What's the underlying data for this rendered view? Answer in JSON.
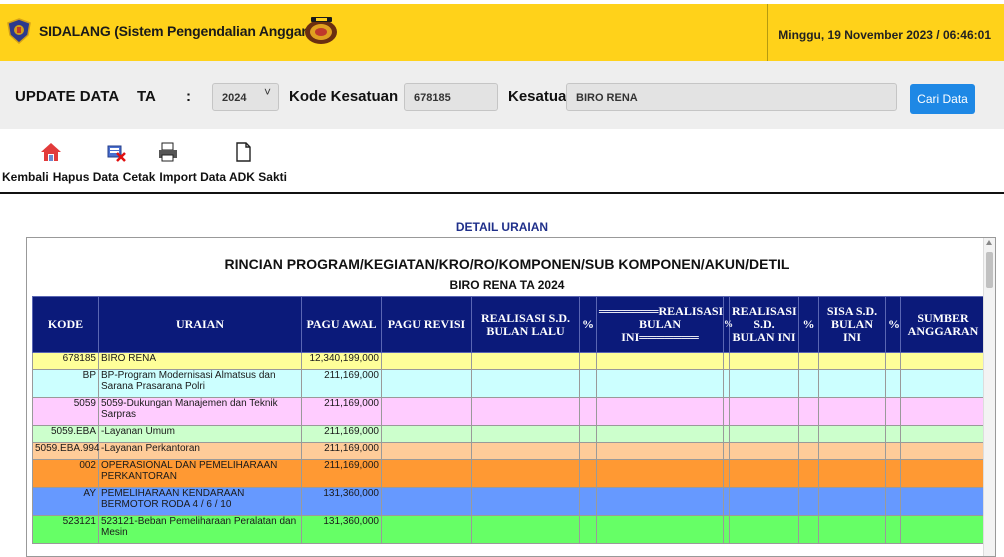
{
  "app": {
    "title": "SIDALANG (Sistem Pengendalian Anggaran)",
    "datetime": "Minggu, 19 November 2023 / 06:46:01"
  },
  "filter": {
    "label_update": "UPDATE DATA",
    "label_ta": "TA",
    "colon": ":",
    "ta_value": "2024",
    "label_kode": "Kode Kesatuan",
    "kode_value": "678185",
    "label_kesatuan": "Kesatuan",
    "kesatuan_value": "BIRO RENA",
    "search_button": "Cari Data"
  },
  "toolbar": {
    "kembali": "Kembali",
    "hapus": "Hapus Data",
    "cetak": "Cetak",
    "import": "Import Data ADK Sakti"
  },
  "detail": {
    "section_title": "DETAIL URAIAN",
    "heading": "RINCIAN PROGRAM/KEGIATAN/KRO/RO/KOMPONEN/SUB KOMPONEN/AKUN/DETIL",
    "subheading": "BIRO RENA TA 2024"
  },
  "table": {
    "headers": [
      "KODE",
      "URAIAN",
      "PAGU AWAL",
      "PAGU REVISI",
      "REALISASI S.D. BULAN LALU",
      "%",
      "═══════REALISASI BULAN INI═══════",
      "%",
      "REALISASI S.D. BULAN INI",
      "%",
      "SISA S.D. BULAN INI",
      "%",
      "SUMBER ANGGARAN"
    ],
    "rows": [
      {
        "kode": "678185",
        "uraian": "BIRO RENA",
        "pagu_awal": "12,340,199,000",
        "color": "#ffff99"
      },
      {
        "kode": "BP",
        "uraian": "BP-Program Modernisasi Almatsus dan Sarana Prasarana Polri",
        "pagu_awal": "211,169,000",
        "color": "#ccffff"
      },
      {
        "kode": "5059",
        "uraian": "5059-Dukungan Manajemen dan Teknik Sarpras",
        "pagu_awal": "211,169,000",
        "color": "#ffccff"
      },
      {
        "kode": "5059.EBA",
        "uraian": "-Layanan Umum",
        "pagu_awal": "211,169,000",
        "color": "#ccffcc"
      },
      {
        "kode": "5059.EBA.994",
        "uraian": "-Layanan Perkantoran",
        "pagu_awal": "211,169,000",
        "color": "#ffcc99"
      },
      {
        "kode": "002",
        "uraian": "OPERASIONAL DAN PEMELIHARAAN PERKANTORAN",
        "pagu_awal": "211,169,000",
        "color": "#ff9933"
      },
      {
        "kode": "AY",
        "uraian": "PEMELIHARAAN KENDARAAN BERMOTOR RODA 4 / 6 / 10",
        "pagu_awal": "131,360,000",
        "color": "#6699ff"
      },
      {
        "kode": "523121",
        "uraian": "523121-Beban Pemeliharaan Peralatan dan Mesin",
        "pagu_awal": "131,360,000",
        "color": "#66ff66"
      }
    ]
  },
  "colors": {
    "topbar": "#ffd21a",
    "header_fill": "#0b1a7a",
    "button": "#1e88e5"
  }
}
